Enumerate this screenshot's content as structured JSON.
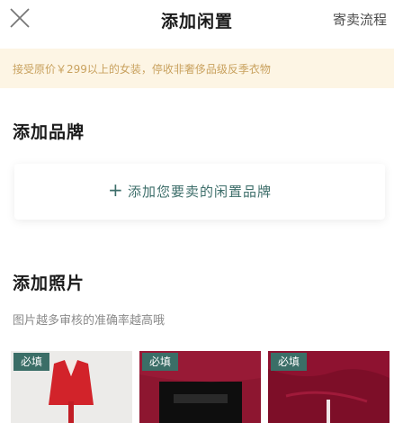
{
  "header": {
    "title": "添加闲置",
    "process_link": "寄卖流程"
  },
  "notice": {
    "text": "接受原价￥299以上的女装，停收非奢侈品级反季衣物"
  },
  "brand": {
    "section_title": "添加品牌",
    "plus_symbol": "+",
    "add_label": "添加您要卖的闲置品牌"
  },
  "photos": {
    "section_title": "添加照片",
    "hint": "图片越多审核的准确率越高哦",
    "slots": [
      {
        "badge": "必填",
        "image": "red dress on white background"
      },
      {
        "badge": "必填",
        "image": "burgundy garment with black label"
      },
      {
        "badge": "必填",
        "image": "burgundy ruched fabric close-up"
      }
    ]
  },
  "colors": {
    "accent": "#3d6e6a",
    "notice_bg": "#fdf5e4",
    "notice_text": "#c9a25f",
    "badge_bg": "#3b6e67"
  }
}
